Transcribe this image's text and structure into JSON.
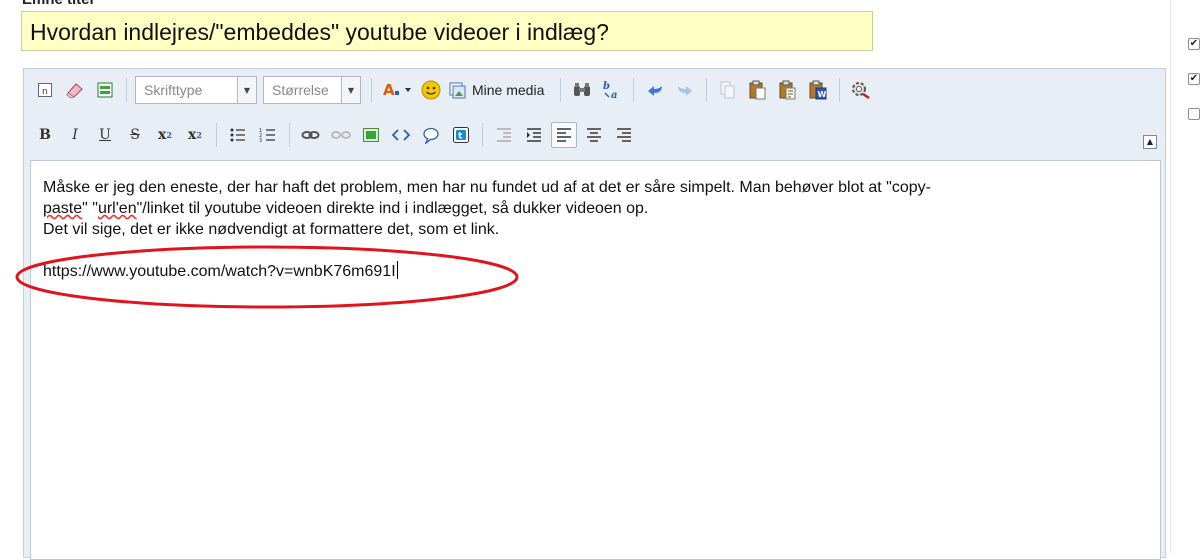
{
  "subject": {
    "label": "Emne titel",
    "value": "Hvordan indlejres/\"embeddes\" youtube videoer i indlæg?"
  },
  "toolbar": {
    "font_dropdown": "Skrifttype",
    "size_dropdown": "Størrelse",
    "mine_media_label": "Mine media",
    "bold_label": "B",
    "italic_label": "I",
    "underline_label": "U",
    "strike_label": "S",
    "subscript_label": "x",
    "superscript_label": "x"
  },
  "editor": {
    "paragraph1_a": "Måske er jeg den eneste, der har haft det problem, men har nu fundet ud af at det er såre simpelt. Man behøver blot at \"copy-",
    "paste_word": "paste",
    "paragraph1_mid": "\" \"",
    "urlen_word": "url'en",
    "paragraph1_b": "\"/linket til youtube videoen direkte ind i indlægget, så dukker videoen op.",
    "paragraph2": "Det vil sige, det er ikke nødvendigt at formattere det, som et link.",
    "url": "https://www.youtube.com/watch?v=wnbK76m691I"
  },
  "colors": {
    "subject_bg": "#ffffc4",
    "toolbar_bg": "#e8eef6",
    "annotation_red": "#e0141e"
  },
  "sidebar": {
    "checkboxes": [
      true,
      true,
      false
    ]
  }
}
